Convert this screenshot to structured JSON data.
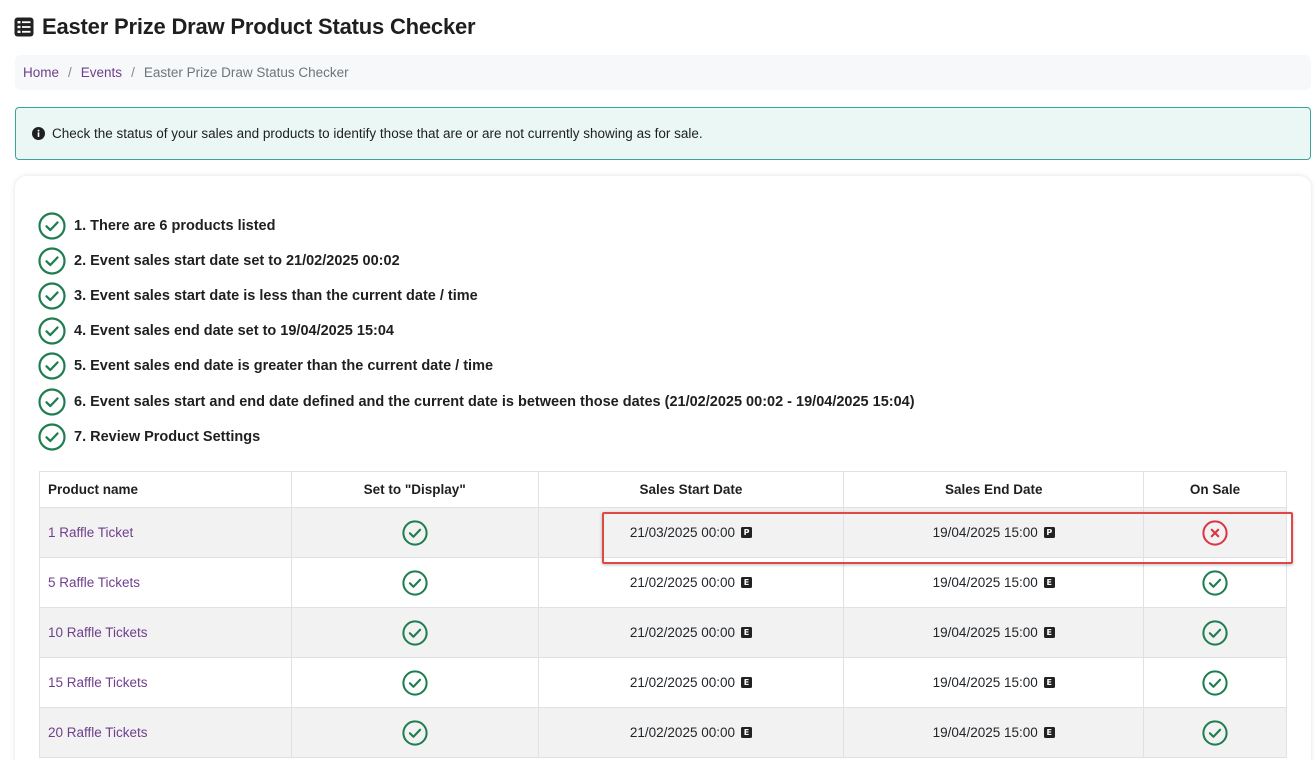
{
  "page": {
    "title": "Easter Prize Draw Product Status Checker",
    "title_icon": "checklist-icon"
  },
  "breadcrumb": {
    "items": [
      {
        "label": "Home"
      },
      {
        "label": "Events"
      },
      {
        "label": "Easter Prize Draw Status Checker"
      }
    ]
  },
  "alert": {
    "icon": "info-icon",
    "text": "Check the status of your sales and products to identify those that are or are not currently showing as for sale."
  },
  "checks": [
    {
      "text": "1. There are 6 products listed",
      "status": "pass"
    },
    {
      "text": "2. Event sales start date set to 21/02/2025 00:02",
      "status": "pass"
    },
    {
      "text": "3. Event sales start date is less than the current date / time",
      "status": "pass"
    },
    {
      "text": "4. Event sales end date set to 19/04/2025 15:04",
      "status": "pass"
    },
    {
      "text": "5. Event sales end date is greater than the current date / time",
      "status": "pass"
    },
    {
      "text": "6. Event sales start and end date defined and the current date is between those dates (21/02/2025 00:02 - 19/04/2025 15:04)",
      "status": "pass"
    },
    {
      "text": "7. Review Product Settings",
      "status": "pass"
    }
  ],
  "table": {
    "headers": {
      "name": "Product name",
      "display": "Set to \"Display\"",
      "start": "Sales Start Date",
      "end": "Sales End Date",
      "on_sale": "On Sale"
    },
    "rows": [
      {
        "name": "1 Raffle Ticket",
        "display": "yes",
        "start": "21/03/2025 00:00",
        "start_badge": "P",
        "end": "19/04/2025 15:00",
        "end_badge": "P",
        "on_sale": "no"
      },
      {
        "name": "5 Raffle Tickets",
        "display": "yes",
        "start": "21/02/2025 00:00",
        "start_badge": "E",
        "end": "19/04/2025 15:00",
        "end_badge": "E",
        "on_sale": "yes"
      },
      {
        "name": "10 Raffle Tickets",
        "display": "yes",
        "start": "21/02/2025 00:00",
        "start_badge": "E",
        "end": "19/04/2025 15:00",
        "end_badge": "E",
        "on_sale": "yes"
      },
      {
        "name": "15 Raffle Tickets",
        "display": "yes",
        "start": "21/02/2025 00:00",
        "start_badge": "E",
        "end": "19/04/2025 15:00",
        "end_badge": "E",
        "on_sale": "yes"
      },
      {
        "name": "20 Raffle Tickets",
        "display": "yes",
        "start": "21/02/2025 00:00",
        "start_badge": "E",
        "end": "19/04/2025 15:00",
        "end_badge": "E",
        "on_sale": "yes"
      }
    ]
  },
  "colors": {
    "pass_green": "#1e7e4f",
    "fail_red": "#dc3545",
    "link_purple": "#6f3f8d",
    "highlight_red": "#e04848"
  }
}
